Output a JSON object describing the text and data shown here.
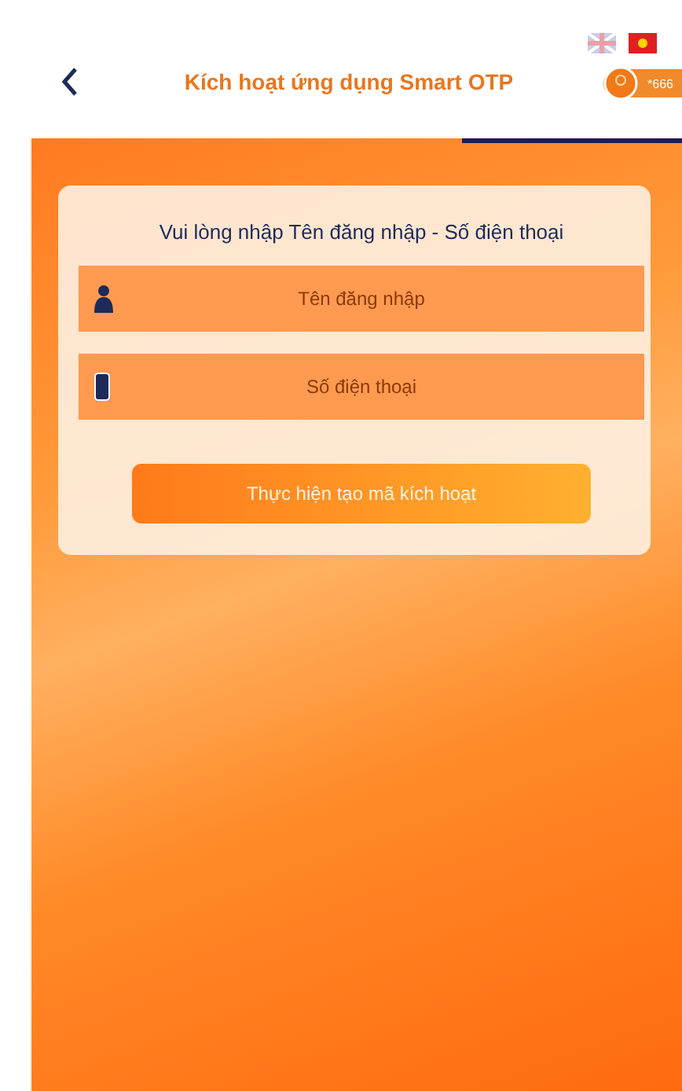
{
  "header": {
    "title": "Kích hoạt ứng dụng Smart OTP",
    "account": "*666"
  },
  "form": {
    "heading": "Vui lòng nhập Tên đăng nhập - Số điện thoại",
    "fields": [
      {
        "kind": "user",
        "placeholder": "Tên đăng nhập"
      },
      {
        "kind": "phone",
        "placeholder": "Số điện thoại"
      }
    ],
    "button": "Thực hiện tạo mã kích hoạt"
  }
}
